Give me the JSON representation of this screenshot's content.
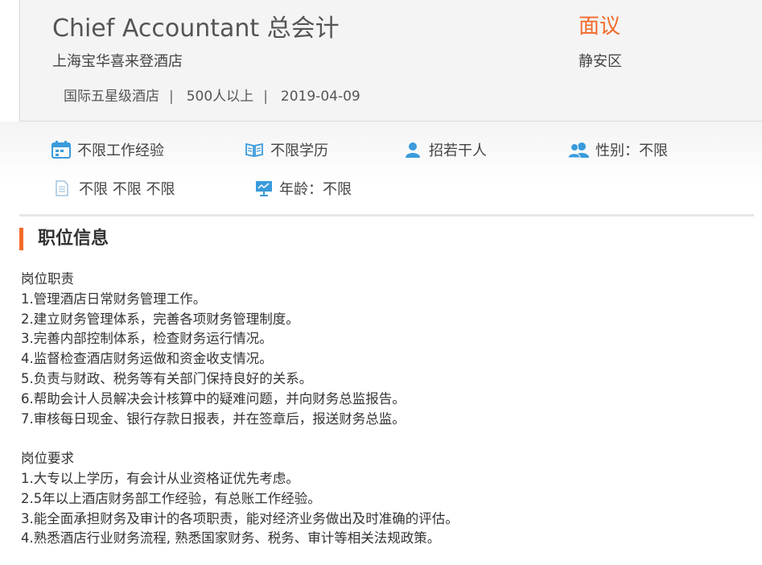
{
  "header": {
    "title": "Chief Accountant 总会计",
    "salary": "面议",
    "company": "上海宝华喜来登酒店",
    "district": "静安区",
    "tags": [
      "国际五星级酒店",
      "500人以上",
      "2019-04-09"
    ],
    "separator": "|"
  },
  "attributes": {
    "experience": "不限工作经验",
    "education": "不限学历",
    "headcount": "招若干人",
    "gender": "性别：不限",
    "misc": "不限 不限 不限",
    "age": "年龄：不限",
    "icon_color": "#3a9bdc"
  },
  "section": {
    "title": "职位信息",
    "accent_color": "#f26b2b"
  },
  "duties": {
    "heading": "岗位职责",
    "items": [
      "1.管理酒店日常财务管理工作。",
      "2.建立财务管理体系，完善各项财务管理制度。",
      "3.完善内部控制体系，检查财务运行情况。",
      "4.监督检查酒店财务运做和资金收支情况。",
      "5.负责与财政、税务等有关部门保持良好的关系。",
      "6.帮助会计人员解决会计核算中的疑难问题，并向财务总监报告。",
      "7.审核每日现金、银行存款日报表，并在签章后，报送财务总监。"
    ]
  },
  "requirements": {
    "heading": "岗位要求",
    "items": [
      "1.大专以上学历，有会计从业资格证优先考虑。",
      "2.5年以上酒店财务部工作经验，有总账工作经验。",
      "3.能全面承担财务及审计的各项职责，能对经济业务做出及时准确的评估。",
      "4.熟悉酒店行业财务流程, 熟悉国家财务、税务、审计等相关法规政策。"
    ]
  }
}
